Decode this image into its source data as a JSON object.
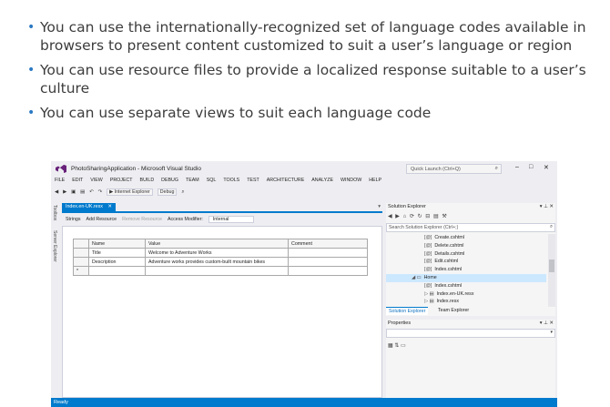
{
  "bullets": [
    "You can use the internationally-recognized set of language codes available in browsers to present content customized to suit a user’s language or region",
    "You can use resource files to provide a localized response suitable to a user’s culture",
    "You can use separate views to suit each language code"
  ],
  "colors": {
    "accent": "#007acc",
    "bullet": "#2b79c2",
    "vs_logo": "#68217a",
    "selection": "#cce8ff"
  },
  "window": {
    "title": "PhotoSharingApplication - Microsoft Visual Studio",
    "quick_launch": "Quick Launch (Ctrl+Q)",
    "buttons": {
      "minimize": "–",
      "restore": "□",
      "close": "✕"
    }
  },
  "menu": [
    "FILE",
    "EDIT",
    "VIEW",
    "PROJECT",
    "BUILD",
    "DEBUG",
    "TEAM",
    "SQL",
    "TOOLS",
    "TEST",
    "ARCHITECTURE",
    "ANALYZE",
    "WINDOW",
    "HELP"
  ],
  "toolbar": {
    "run_target": "▶ Internet Explorer",
    "config": "Debug"
  },
  "left_strip": {
    "toolbox": "Toolbox",
    "server_explorer": "Server Explorer"
  },
  "document": {
    "tab": "Index.en-UK.resx",
    "tab_close": "✕",
    "resource_toolbar": {
      "strings": "Strings",
      "add_resource": "Add Resource",
      "remove_resource": "Remove Resource",
      "access_label": "Access Modifier:",
      "access_value": "Internal"
    },
    "columns": [
      "Name",
      "Value",
      "Comment"
    ],
    "rows": [
      {
        "name": "Title",
        "value": "Welcome to Adventure Works",
        "comment": ""
      },
      {
        "name": "Description",
        "value": "Adventure works provides custom-built mountain bikes",
        "comment": ""
      }
    ],
    "new_row_marker": "*"
  },
  "solution_explorer": {
    "title": "Solution Explorer",
    "search_placeholder": "Search Solution Explorer (Ctrl+;)",
    "items": [
      {
        "label": "Create.cshtml",
        "badge": "[@]",
        "indent": 3,
        "selected": false
      },
      {
        "label": "Delete.cshtml",
        "badge": "[@]",
        "indent": 3,
        "selected": false
      },
      {
        "label": "Details.cshtml",
        "badge": "[@]",
        "indent": 3,
        "selected": false
      },
      {
        "label": "Edit.cshtml",
        "badge": "[@]",
        "indent": 3,
        "selected": false
      },
      {
        "label": "Index.cshtml",
        "badge": "[@]",
        "indent": 3,
        "selected": false
      },
      {
        "label": "Home",
        "badge": "◢ ▭",
        "indent": 2,
        "selected": true
      },
      {
        "label": "Index.cshtml",
        "badge": "[@]",
        "indent": 3,
        "selected": false
      },
      {
        "label": "Index.en-UK.resx",
        "badge": "▷ ▤",
        "indent": 3,
        "selected": false
      },
      {
        "label": "Index.resx",
        "badge": "▷ ▤",
        "indent": 3,
        "selected": false
      }
    ],
    "tabs": [
      "Solution Explorer",
      "Team Explorer"
    ]
  },
  "properties": {
    "title": "Properties"
  },
  "status": {
    "text": "Ready"
  }
}
